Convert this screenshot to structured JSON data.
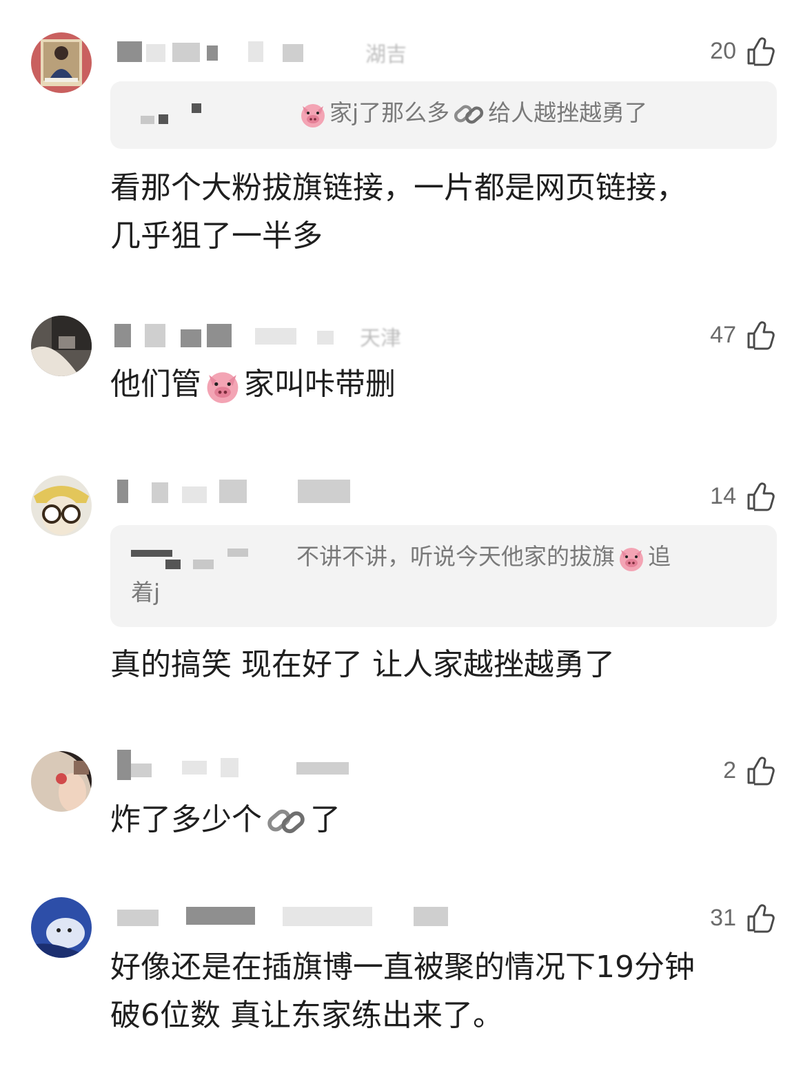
{
  "comments": [
    {
      "likes": "20",
      "username_tail": "湖吉",
      "quote": {
        "segments": [
          "家j了那么多",
          "给人越挫越勇了"
        ]
      },
      "text_segments": [
        "看那个大粉拔旗链接，一片都是网页链接，",
        "几乎狙了一半多"
      ]
    },
    {
      "likes": "47",
      "username_tail": "天津",
      "text_segments": [
        "他们管",
        "家叫咔带删"
      ]
    },
    {
      "likes": "14",
      "username_tail": "",
      "quote": {
        "segments": [
          "不讲不讲，听说今天他家的拔旗",
          "追",
          "着j"
        ]
      },
      "text_segments": [
        "真的搞笑 现在好了 让人家越挫越勇了"
      ]
    },
    {
      "likes": "2",
      "username_tail": "",
      "text_segments": [
        "炸了多少个",
        "了"
      ]
    },
    {
      "likes": "31",
      "username_tail": "",
      "text_segments": [
        "好像还是在插旗博一直被聚的情况下19分钟",
        "破6位数 真让东家练出来了。"
      ]
    }
  ],
  "icons": {
    "like": "thumbs-up-icon",
    "pig": "pig-face-emoji",
    "link": "link-emoji"
  },
  "colors": {
    "text": "#1f1f1f",
    "muted": "#6b6b6b",
    "quote_bg": "#f3f3f3"
  }
}
